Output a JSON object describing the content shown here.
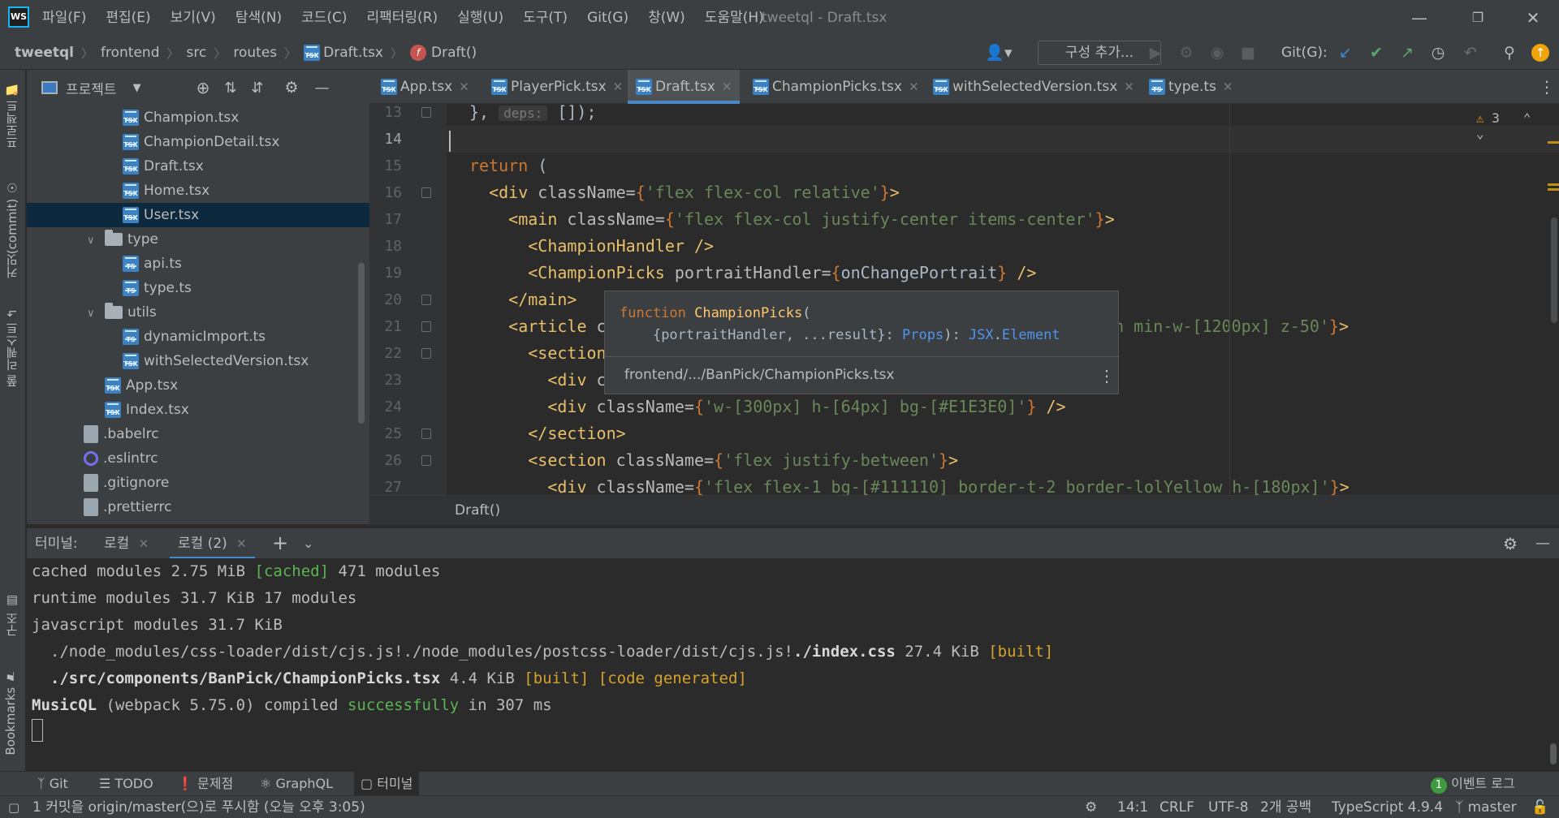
{
  "menu": {
    "items": [
      "파일(F)",
      "편집(E)",
      "보기(V)",
      "탐색(N)",
      "코드(C)",
      "리팩터링(R)",
      "실행(U)",
      "도구(T)",
      "Git(G)",
      "창(W)",
      "도움말(H)"
    ],
    "window_title": "tweetql - Draft.tsx",
    "logo_text": "WS"
  },
  "navbar": {
    "breadcrumb": [
      "tweetql",
      "frontend",
      "src",
      "routes",
      "Draft.tsx",
      "Draft()"
    ],
    "config_button": "구성 추가...",
    "git_label": "Git(G):"
  },
  "left_strip": {
    "project_tab": "프로젝트",
    "commit_tab": "커밋(commit)",
    "pull_requests_tab": "풀 리퀘스트",
    "structure_tab": "구조",
    "bookmarks_tab": "Bookmarks"
  },
  "project_panel": {
    "title": "프로젝트",
    "tree": [
      {
        "label": "Champion.tsx",
        "type": "tsx",
        "level": 3
      },
      {
        "label": "ChampionDetail.tsx",
        "type": "tsx",
        "level": 3
      },
      {
        "label": "Draft.tsx",
        "type": "tsx",
        "level": 3
      },
      {
        "label": "Home.tsx",
        "type": "tsx",
        "level": 3
      },
      {
        "label": "User.tsx",
        "type": "tsx",
        "level": 3,
        "selected": true
      },
      {
        "label": "type",
        "type": "folder",
        "level": 2,
        "expanded": true
      },
      {
        "label": "api.ts",
        "type": "ts",
        "level": 3
      },
      {
        "label": "type.ts",
        "type": "ts",
        "level": 3
      },
      {
        "label": "utils",
        "type": "folder",
        "level": 2,
        "expanded": true
      },
      {
        "label": "dynamicImport.ts",
        "type": "ts",
        "level": 3
      },
      {
        "label": "withSelectedVersion.tsx",
        "type": "tsx",
        "level": 3
      },
      {
        "label": "App.tsx",
        "type": "tsx",
        "level": 2
      },
      {
        "label": "Index.tsx",
        "type": "tsx",
        "level": 2
      },
      {
        "label": ".babelrc",
        "type": "gen",
        "level": 1
      },
      {
        "label": ".eslintrc",
        "type": "es",
        "level": 1
      },
      {
        "label": ".gitignore",
        "type": "gen",
        "level": 1
      },
      {
        "label": ".prettierrc",
        "type": "gen",
        "level": 1
      }
    ]
  },
  "editor": {
    "tabs": [
      {
        "label": "App.tsx",
        "active": false
      },
      {
        "label": "PlayerPick.tsx",
        "active": false
      },
      {
        "label": "Draft.tsx",
        "active": true
      },
      {
        "label": "ChampionPicks.tsx",
        "active": false
      },
      {
        "label": "withSelectedVersion.tsx",
        "active": false
      },
      {
        "label": "type.ts",
        "active": false
      }
    ],
    "line_numbers": [
      "13",
      "14",
      "15",
      "16",
      "17",
      "18",
      "19",
      "20",
      "21",
      "22",
      "23",
      "24",
      "25",
      "26",
      "27"
    ],
    "current_line": "14",
    "warning_count": "3",
    "lines": {
      "l13": {
        "pre": "}, ",
        "hint": "deps:",
        "post": " []);"
      },
      "l15": {
        "kw": "return",
        "post": " ("
      },
      "l16": {
        "indent": "  ",
        "tag": "<div",
        "attr": " className=",
        "str": "'flex flex-col relative'",
        "end": ">"
      },
      "l17": {
        "indent": "    ",
        "tag": "<main",
        "attr": " className=",
        "str": "'flex flex-col justify-center items-center'",
        "end": ">"
      },
      "l18": {
        "indent": "      ",
        "tag": "<ChampionHandler",
        "end": " />"
      },
      "l19": {
        "indent": "      ",
        "tag": "<ChampionPicks",
        "attr": " portraitHandler=",
        "expr": "onChangePortrait",
        "end": " />"
      },
      "l20": {
        "indent": "    ",
        "tag": "</main>"
      },
      "l21": {
        "indent": "    ",
        "tag": "<article",
        "attr": " c",
        "tail": "een min-w-[1200px] z-50'",
        "end": ">"
      },
      "l22": {
        "indent": "      ",
        "tag": "<section"
      },
      "l23": {
        "indent": "        ",
        "tag": "<div",
        "attr": " c"
      },
      "l24": {
        "indent": "        ",
        "tag": "<div",
        "attr": " className=",
        "str": "'w-[300px] h-[64px] bg-[#E1E3E0]'",
        "end": " />"
      },
      "l25": {
        "indent": "      ",
        "tag": "</section>"
      },
      "l26": {
        "indent": "      ",
        "tag": "<section",
        "attr": " className=",
        "str": "'flex justify-between'",
        "end": ">"
      },
      "l27": {
        "indent": "        ",
        "tag": "<div",
        "attr": " className=",
        "str": "'flex flex-1 bg-[#111110] border-t-2 border-lolYellow h-[180px]'",
        "end": ">"
      }
    },
    "tooltip": {
      "kw": "function",
      "name": "ChampionPicks",
      "params": "{portraitHandler, ...result}",
      "type_prefix": "Props",
      "ret_ns": "JSX",
      "ret": "Element",
      "path": "frontend/.../BanPick/ChampionPicks.tsx"
    },
    "crumb": "Draft()"
  },
  "terminal": {
    "label": "터미널:",
    "tabs": [
      "로컬",
      "로컬 (2)"
    ],
    "lines": {
      "t1": {
        "a": "cached modules 2.75 MiB ",
        "b": "[cached]",
        "c": " 471 modules"
      },
      "t2": {
        "a": "runtime modules 31.7 KiB 17 modules"
      },
      "t3": {
        "a": "javascript modules 31.7 KiB"
      },
      "t4": {
        "a": "  ./node_modules/css-loader/dist/cjs.js!./node_modules/postcss-loader/dist/cjs.js!",
        "bold": "./index.css",
        "c": " 27.4 KiB ",
        "d": "[built]"
      },
      "t5": {
        "bold": "  ./src/components/BanPick/ChampionPicks.tsx",
        "c": " 4.4 KiB ",
        "d": "[built] [code generated]"
      },
      "t6": {
        "bold": "MusicQL",
        "c": " (webpack 5.75.0) compiled ",
        "g": "successfully",
        "e": " in 307 ms"
      }
    }
  },
  "tool_tabs": [
    "Git",
    "TODO",
    "문제점",
    "GraphQL",
    "터미널"
  ],
  "event_log": {
    "count": "1",
    "label": "이벤트 로그"
  },
  "status": {
    "message": "1 커밋을 origin/master(으)로 푸시함 (오늘 오후 3:05)",
    "position": "14:1",
    "line_sep": "CRLF",
    "encoding": "UTF-8",
    "indent": "2개 공백",
    "language": "TypeScript 4.9.4",
    "branch": "master"
  },
  "colors": {
    "accent": "#4a88c7",
    "selection": "#0d293e",
    "background": "#2b2b2b",
    "panel": "#3c3f41"
  }
}
